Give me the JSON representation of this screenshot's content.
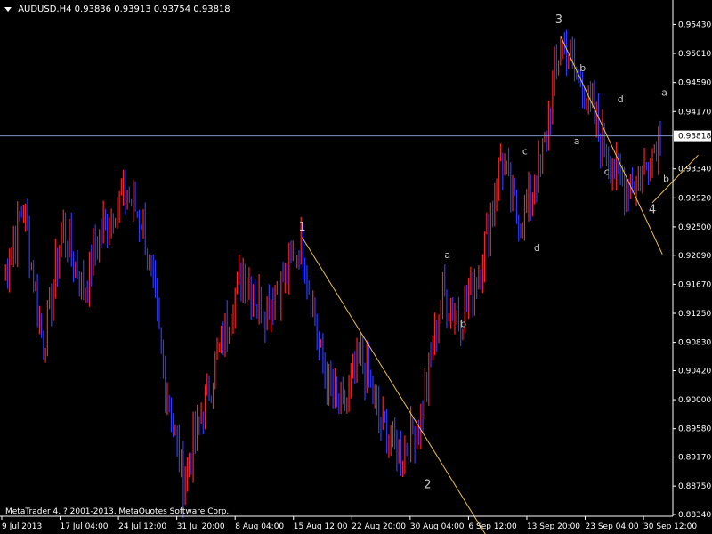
{
  "header": {
    "symbol": "AUDUSD,H4",
    "open": "0.93836",
    "high": "0.93913",
    "low": "0.93754",
    "close": "0.93818"
  },
  "footer": {
    "copyright": "MetaTrader 4, ? 2001-2013, MetaQuotes Software Corp."
  },
  "colors": {
    "background": "#000000",
    "bull": "#ff2020",
    "bear": "#2a3cff",
    "axis": "#ffffff",
    "trendline": "#f0c040",
    "priceline": "#7f93c8",
    "wave_label": "#c8c8c8"
  },
  "chart_data": {
    "type": "bar",
    "title": "AUDUSD,H4",
    "ylim": [
      0.8834,
      0.9568
    ],
    "y_ticks": [
      "0.95430",
      "0.95010",
      "0.94590",
      "0.94170",
      "0.93818",
      "0.93340",
      "0.92920",
      "0.92500",
      "0.92090",
      "0.91670",
      "0.91250",
      "0.90830",
      "0.90420",
      "0.90000",
      "0.89580",
      "0.89170",
      "0.88750",
      "0.88340"
    ],
    "x_ticks": [
      "9 Jul 2013",
      "17 Jul 04:00",
      "24 Jul 12:00",
      "31 Jul 20:00",
      "8 Aug 04:00",
      "15 Aug 12:00",
      "22 Aug 20:00",
      "30 Aug 04:00",
      "6 Sep 12:00",
      "13 Sep 20:00",
      "23 Sep 04:00",
      "30 Sep 12:00"
    ],
    "current_price": "0.93818",
    "series": [
      {
        "label_points": [
          [
            "9 Jul 2013",
            0.918
          ],
          [
            "11 Jul",
            0.928
          ],
          [
            "13 Jul",
            0.908
          ],
          [
            "17 Jul 04:00",
            0.925
          ],
          [
            "19 Jul",
            0.916
          ],
          [
            "22 Jul",
            0.925
          ],
          [
            "24 Jul 12:00",
            0.93
          ],
          [
            "26 Jul",
            0.926
          ],
          [
            "29 Jul",
            0.905
          ],
          [
            "31 Jul 20:00",
            0.888
          ],
          [
            "3 Aug",
            0.898
          ],
          [
            "6 Aug",
            0.909
          ],
          [
            "8 Aug 04:00",
            0.919
          ],
          [
            "10 Aug",
            0.913
          ],
          [
            "13 Aug",
            0.917
          ],
          [
            "15 Aug 12:00",
            0.923
          ],
          [
            "18 Aug",
            0.905
          ],
          [
            "20 Aug",
            0.898
          ],
          [
            "22 Aug 20:00",
            0.906
          ],
          [
            "25 Aug",
            0.896
          ],
          [
            "28 Aug",
            0.892
          ],
          [
            "30 Aug 04:00",
            0.898
          ],
          [
            "2 Sep",
            0.915
          ],
          [
            "4 Sep",
            0.912
          ],
          [
            "6 Sep 12:00",
            0.92
          ],
          [
            "9 Sep",
            0.935
          ],
          [
            "11 Sep",
            0.925
          ],
          [
            "13 Sep 20:00",
            0.934
          ],
          [
            "16 Sep",
            0.952
          ],
          [
            "19 Sep",
            0.946
          ],
          [
            "23 Sep 04:00",
            0.938
          ],
          [
            "26 Sep",
            0.931
          ],
          [
            "28 Sep",
            0.932
          ],
          [
            "30 Sep 12:00",
            0.939
          ]
        ]
      }
    ],
    "wave_labels": [
      {
        "text": "1",
        "date": "15 Aug 12:00",
        "price": 0.9245
      },
      {
        "text": "2",
        "date": "30 Aug 04:00",
        "price": 0.8872
      },
      {
        "text": "3",
        "date": "13 Sep 20:00",
        "price": 0.9545
      },
      {
        "text": "4",
        "date": "30 Sep 12:00",
        "price": 0.927
      },
      {
        "text": "a",
        "date": "2 Sep",
        "price": 0.9205
      },
      {
        "text": "b",
        "date": "4 Sep",
        "price": 0.9105
      },
      {
        "text": "c",
        "date": "11 Sep",
        "price": 0.9355
      },
      {
        "text": "d",
        "date": "12 Sep",
        "price": 0.9215
      },
      {
        "text": "b",
        "date": "19 Sep",
        "price": 0.9475
      },
      {
        "text": "a",
        "date": "20 Sep",
        "price": 0.937
      },
      {
        "text": "d",
        "date": "26 Sep",
        "price": 0.943
      },
      {
        "text": "c",
        "date": "25 Sep",
        "price": 0.9325
      },
      {
        "text": "a",
        "date": "1 Oct",
        "price": 0.944
      },
      {
        "text": "b",
        "date": "1 Oct",
        "price": 0.9315
      }
    ]
  }
}
